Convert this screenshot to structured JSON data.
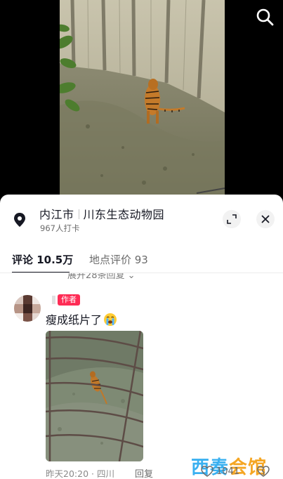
{
  "video": {
    "description_icon": "search-icon"
  },
  "location": {
    "city": "内江市",
    "place": "川东生态动物园",
    "checkins": "967人打卡"
  },
  "tabs": {
    "comments": "评论 10.5万",
    "reviews": "地点评价 93"
  },
  "expand_replies": "展开28条回复 ⌄",
  "comment": {
    "badge": "作者",
    "text": "瘦成纸片了",
    "time": "昨天20:20",
    "region": "四川",
    "meta_sep": " · ",
    "reply": "回复",
    "likes": "1041"
  },
  "watermark": {
    "part1": "西奏",
    "part2": "会馆"
  },
  "colors": {
    "accent": "#fe2c55",
    "text_primary": "#161823",
    "text_secondary": "#8a8a8a"
  }
}
